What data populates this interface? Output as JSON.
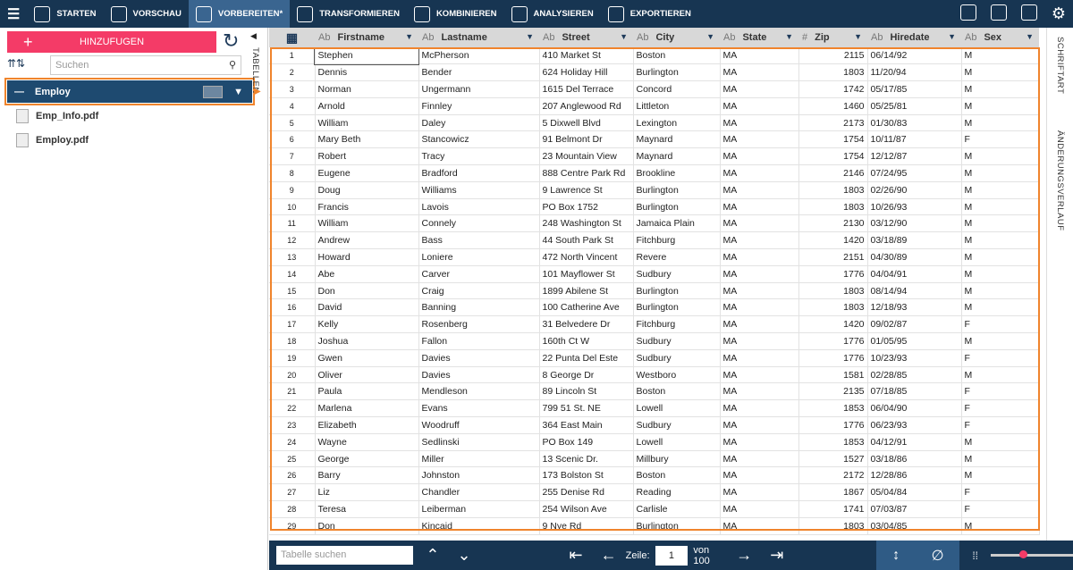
{
  "toolbar": {
    "items": [
      "STARTEN",
      "VORSCHAU",
      "VORBEREITEN*",
      "TRANSFORMIEREN",
      "KOMBINIEREN",
      "ANALYSIEREN",
      "EXPORTIEREN"
    ]
  },
  "left": {
    "add_label": "HINZUFUGEN",
    "search_placeholder": "Suchen",
    "table_name": "Employ",
    "files": [
      "Emp_Info.pdf",
      "Employ.pdf"
    ],
    "tab_label": "TABELLEN"
  },
  "right": {
    "tabs": [
      "SCHRIFTART",
      "ÄNDERUNGSVERLAUF"
    ]
  },
  "columns": [
    {
      "type": "Ab",
      "name": "Firstname"
    },
    {
      "type": "Ab",
      "name": "Lastname"
    },
    {
      "type": "Ab",
      "name": "Street"
    },
    {
      "type": "Ab",
      "name": "City"
    },
    {
      "type": "Ab",
      "name": "State"
    },
    {
      "type": "#",
      "name": "Zip"
    },
    {
      "type": "Ab",
      "name": "Hiredate"
    },
    {
      "type": "Ab",
      "name": "Sex"
    }
  ],
  "rows": [
    [
      "1",
      "Stephen",
      "McPherson",
      "410 Market St",
      "Boston",
      "MA",
      "2115",
      "06/14/92",
      "M"
    ],
    [
      "2",
      "Dennis",
      "Bender",
      "624 Holiday Hill",
      "Burlington",
      "MA",
      "1803",
      "11/20/94",
      "M"
    ],
    [
      "3",
      "Norman",
      "Ungermann",
      "1615 Del Terrace",
      "Concord",
      "MA",
      "1742",
      "05/17/85",
      "M"
    ],
    [
      "4",
      "Arnold",
      "Finnley",
      "207 Anglewood Rd",
      "Littleton",
      "MA",
      "1460",
      "05/25/81",
      "M"
    ],
    [
      "5",
      "William",
      "Daley",
      "5 Dixwell Blvd",
      "Lexington",
      "MA",
      "2173",
      "01/30/83",
      "M"
    ],
    [
      "6",
      "Mary Beth",
      "Stancowicz",
      "91 Belmont Dr",
      "Maynard",
      "MA",
      "1754",
      "10/11/87",
      "F"
    ],
    [
      "7",
      "Robert",
      "Tracy",
      "23 Mountain View",
      "Maynard",
      "MA",
      "1754",
      "12/12/87",
      "M"
    ],
    [
      "8",
      "Eugene",
      "Bradford",
      "888 Centre Park Rd",
      "Brookline",
      "MA",
      "2146",
      "07/24/95",
      "M"
    ],
    [
      "9",
      "Doug",
      "Williams",
      "9 Lawrence St",
      "Burlington",
      "MA",
      "1803",
      "02/26/90",
      "M"
    ],
    [
      "10",
      "Francis",
      "Lavois",
      "PO Box 1752",
      "Burlington",
      "MA",
      "1803",
      "10/26/93",
      "M"
    ],
    [
      "11",
      "William",
      "Connely",
      "248 Washington St",
      "Jamaica Plain",
      "MA",
      "2130",
      "03/12/90",
      "M"
    ],
    [
      "12",
      "Andrew",
      "Bass",
      "44 South Park St",
      "Fitchburg",
      "MA",
      "1420",
      "03/18/89",
      "M"
    ],
    [
      "13",
      "Howard",
      "Loniere",
      "472 North Vincent",
      "Revere",
      "MA",
      "2151",
      "04/30/89",
      "M"
    ],
    [
      "14",
      "Abe",
      "Carver",
      "101 Mayflower St",
      "Sudbury",
      "MA",
      "1776",
      "04/04/91",
      "M"
    ],
    [
      "15",
      "Don",
      "Craig",
      "1899 Abilene St",
      "Burlington",
      "MA",
      "1803",
      "08/14/94",
      "M"
    ],
    [
      "16",
      "David",
      "Banning",
      "100 Catherine Ave",
      "Burlington",
      "MA",
      "1803",
      "12/18/93",
      "M"
    ],
    [
      "17",
      "Kelly",
      "Rosenberg",
      "31 Belvedere Dr",
      "Fitchburg",
      "MA",
      "1420",
      "09/02/87",
      "F"
    ],
    [
      "18",
      "Joshua",
      "Fallon",
      "160th Ct W",
      "Sudbury",
      "MA",
      "1776",
      "01/05/95",
      "M"
    ],
    [
      "19",
      "Gwen",
      "Davies",
      "22 Punta Del Este",
      "Sudbury",
      "MA",
      "1776",
      "10/23/93",
      "F"
    ],
    [
      "20",
      "Oliver",
      "Davies",
      "8 George Dr",
      "Westboro",
      "MA",
      "1581",
      "02/28/85",
      "M"
    ],
    [
      "21",
      "Paula",
      "Mendleson",
      "89 Lincoln St",
      "Boston",
      "MA",
      "2135",
      "07/18/85",
      "F"
    ],
    [
      "22",
      "Marlena",
      "Evans",
      "799 51 St. NE",
      "Lowell",
      "MA",
      "1853",
      "06/04/90",
      "F"
    ],
    [
      "23",
      "Elizabeth",
      "Woodruff",
      "364 East Main",
      "Sudbury",
      "MA",
      "1776",
      "06/23/93",
      "F"
    ],
    [
      "24",
      "Wayne",
      "Sedlinski",
      "PO Box 149",
      "Lowell",
      "MA",
      "1853",
      "04/12/91",
      "M"
    ],
    [
      "25",
      "George",
      "Miller",
      "13 Scenic Dr.",
      "Millbury",
      "MA",
      "1527",
      "03/18/86",
      "M"
    ],
    [
      "26",
      "Barry",
      "Johnston",
      "173 Bolston St",
      "Boston",
      "MA",
      "2172",
      "12/28/86",
      "M"
    ],
    [
      "27",
      "Liz",
      "Chandler",
      "255 Denise Rd",
      "Reading",
      "MA",
      "1867",
      "05/04/84",
      "F"
    ],
    [
      "28",
      "Teresa",
      "Leiberman",
      "254 Wilson Ave",
      "Carlisle",
      "MA",
      "1741",
      "07/03/87",
      "F"
    ],
    [
      "29",
      "Don",
      "Kincaid",
      "9 Nye Rd",
      "Burlington",
      "MA",
      "1803",
      "03/04/85",
      "M"
    ]
  ],
  "bottom": {
    "search_placeholder": "Tabelle suchen",
    "row_label": "Zeile:",
    "row_value": "1",
    "of_label": "von 100",
    "zoom_fraction": 0.38
  }
}
